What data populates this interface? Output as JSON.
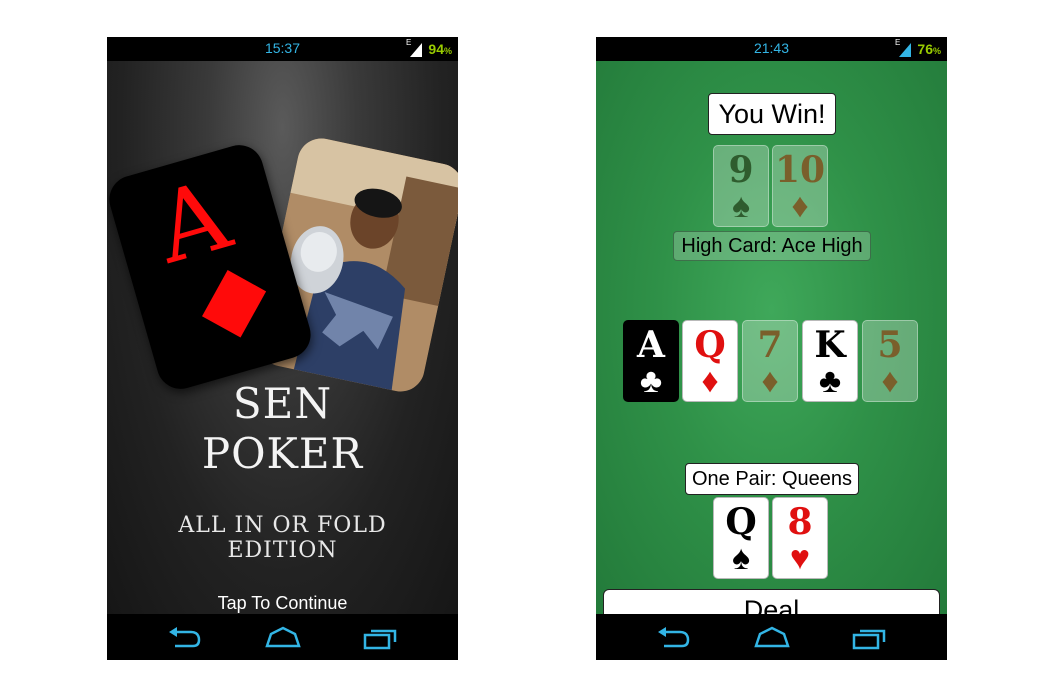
{
  "left_screen": {
    "status": {
      "time": "15:37",
      "network": "E",
      "battery": "94",
      "battery_unit": "%"
    },
    "ace_card": {
      "rank": "A"
    },
    "title_line1": "SEN",
    "title_line2": "POKER",
    "subtitle_line1": "ALL IN OR FOLD",
    "subtitle_line2": "EDITION",
    "tap_prompt": "Tap To Continue"
  },
  "right_screen": {
    "status": {
      "time": "21:43",
      "network": "E",
      "battery": "76",
      "battery_unit": "%"
    },
    "result": "You Win!",
    "opponent_hand_label": "High Card: Ace High",
    "player_hand_label": "One Pair: Queens",
    "deal_button": "Deal",
    "opponent_cards": [
      {
        "rank": "9",
        "suit": "♠"
      },
      {
        "rank": "10",
        "suit": "♦"
      }
    ],
    "community_cards": [
      {
        "rank": "A",
        "suit": "♣"
      },
      {
        "rank": "Q",
        "suit": "♦"
      },
      {
        "rank": "7",
        "suit": "♦"
      },
      {
        "rank": "K",
        "suit": "♣"
      },
      {
        "rank": "5",
        "suit": "♦"
      }
    ],
    "player_cards": [
      {
        "rank": "Q",
        "suit": "♠"
      },
      {
        "rank": "8",
        "suit": "♥"
      }
    ]
  },
  "colors": {
    "status_time": "#33b5e5",
    "battery": "#99cc00",
    "felt": "#2f9148",
    "card_red": "#e01010",
    "ace_red": "#ff0a0a"
  },
  "icons": [
    "back-icon",
    "home-icon",
    "recent-apps-icon",
    "signal-icon"
  ]
}
